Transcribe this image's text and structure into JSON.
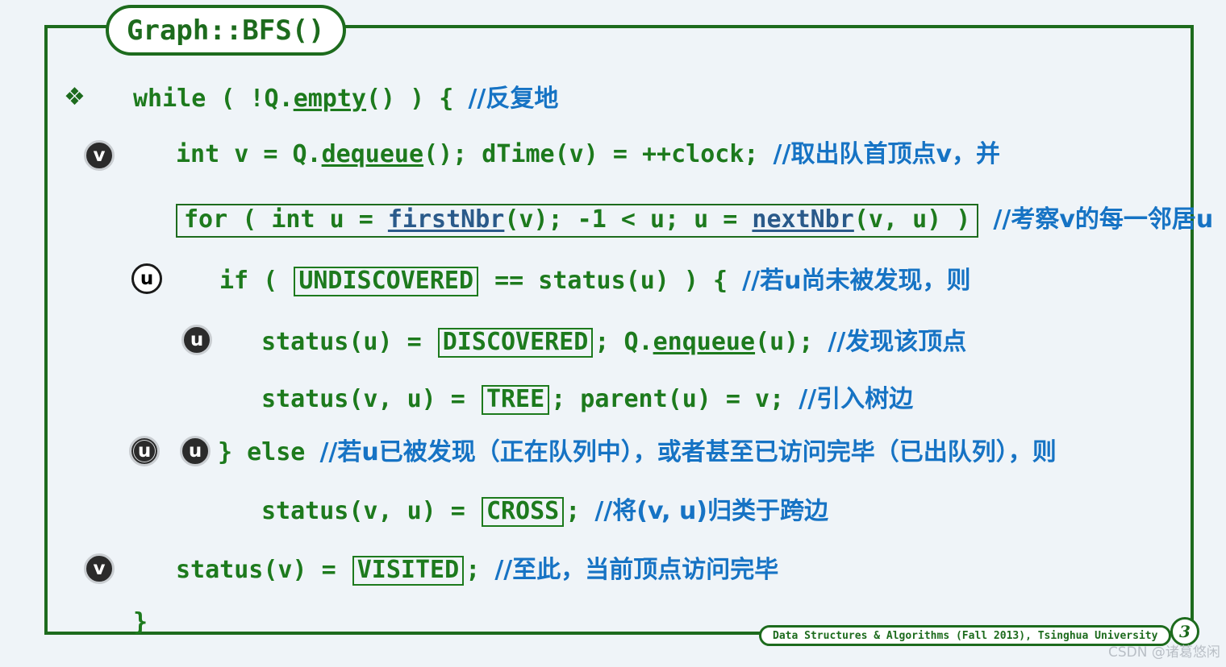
{
  "slide": {
    "title": "Graph::BFS()",
    "background_color": "#eff4f8",
    "frame_color": "#1d6b1d",
    "code_color": "#1d7a1d",
    "comment_color": "#1673c4",
    "bullet_glyph": "❖"
  },
  "code": {
    "line1": {
      "kw": "while ( !Q.",
      "method": "empty",
      "tail": "() ) {",
      "comment": "//反复地"
    },
    "line2": {
      "head": "int v = Q.",
      "method": "dequeue",
      "tail": "(); dTime(v) = ++clock;",
      "comment": "//取出队首顶点v，并",
      "badge": "v"
    },
    "line3": {
      "boxed_head": "for ( int u = ",
      "method1": "firstNbr",
      "boxed_mid": "(v); -1 < u; u = ",
      "method2": "nextNbr",
      "boxed_tail": "(v, u) )",
      "comment": "//考察v的每一邻居u"
    },
    "line4": {
      "head": "if ( ",
      "token": "UNDISCOVERED",
      "tail": " == status(u) ) {",
      "comment": "//若u尚未被发现，则",
      "badge": "u"
    },
    "line5": {
      "head": "status(u) = ",
      "token": "DISCOVERED",
      "mid": "; Q.",
      "method": "enqueue",
      "tail": "(u);",
      "comment": "//发现该顶点",
      "badge": "u"
    },
    "line6": {
      "head": "status(v, u) = ",
      "token": "TREE",
      "tail": "; parent(u) = v;",
      "comment": "//引入树边"
    },
    "line7": {
      "code": "} else",
      "comment": "//若u已被发现（正在队列中），或者甚至已访问完毕（已出队列），则",
      "badge_a": "u",
      "badge_b": "u"
    },
    "line8": {
      "head": "status(v, u) = ",
      "token": "CROSS",
      "tail": ";",
      "comment": "//将(v, u)归类于跨边"
    },
    "line9": {
      "head": "status(v) = ",
      "token": "VISITED",
      "tail": ";",
      "comment": "//至此，当前顶点访问完毕",
      "badge": "v"
    },
    "line10": {
      "code": "}"
    }
  },
  "footer": {
    "course": "Data Structures & Algorithms (Fall 2013), Tsinghua University",
    "page_number": "3",
    "watermark": "CSDN @诸葛悠闲"
  }
}
